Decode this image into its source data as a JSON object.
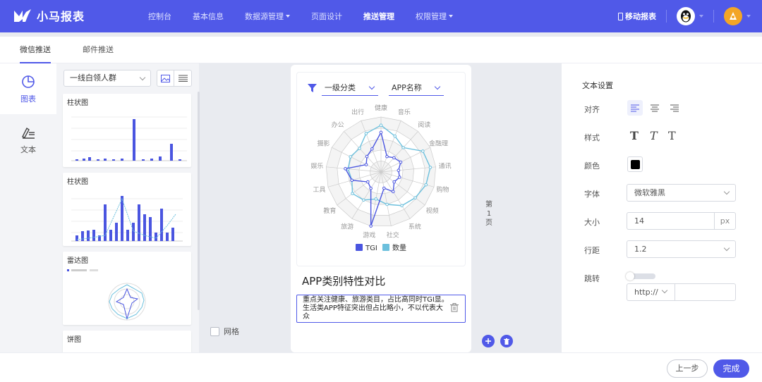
{
  "app": {
    "title": "小马报表"
  },
  "nav": [
    {
      "label": "控制台",
      "dropdown": false,
      "active": false
    },
    {
      "label": "基本信息",
      "dropdown": false,
      "active": false
    },
    {
      "label": "数据源管理",
      "dropdown": true,
      "active": false
    },
    {
      "label": "页面设计",
      "dropdown": false,
      "active": false
    },
    {
      "label": "推送管理",
      "dropdown": false,
      "active": true
    },
    {
      "label": "权限管理",
      "dropdown": true,
      "active": false
    }
  ],
  "header": {
    "mobile_label": "移动报表"
  },
  "tabs": [
    {
      "label": "微信推送",
      "active": true
    },
    {
      "label": "邮件推送",
      "active": false
    }
  ],
  "chart_types": [
    {
      "label": "图表",
      "icon": "pie-chart-icon",
      "active": true
    },
    {
      "label": "文本",
      "icon": "text-pen-icon",
      "active": false
    }
  ],
  "audience_select": {
    "value": "一线白领人群"
  },
  "templates": [
    {
      "title": "柱状图"
    },
    {
      "title": "柱状图"
    },
    {
      "title": "雷达图"
    },
    {
      "title": "饼图"
    }
  ],
  "canvas": {
    "grid_label": "网格",
    "filter1": "一级分类",
    "filter2": "APP名称",
    "chart_title": "APP类别特性对比",
    "chart_desc": "重点关注健康、旅游类目，占比高同时TGI显。生活类APP特征突出但占比略小，不以代表大众",
    "pager": [
      "第",
      "1",
      "页"
    ]
  },
  "settings": {
    "section_title": "文本设置",
    "align_label": "对齐",
    "style_label": "样式",
    "color_label": "颜色",
    "color_value": "#000000",
    "font_label": "字体",
    "font_value": "微软雅黑",
    "size_label": "大小",
    "size_value": "14",
    "size_unit": "px",
    "line_label": "行距",
    "line_value": "1.2",
    "jump_label": "跳转",
    "protocol": "http://",
    "style_glyphs": [
      "T",
      "T",
      "T"
    ]
  },
  "footer": {
    "prev_label": "上一步",
    "done_label": "完成"
  },
  "colors": {
    "primary": "#5059e8",
    "series_tgi": "#4a55e0",
    "series_share": "#6cc0dd"
  },
  "chart_data": {
    "type": "radar",
    "categories": [
      "健康",
      "音乐",
      "阅读",
      "金融理",
      "通讯",
      "购物",
      "视频",
      "系统",
      "社交",
      "游戏",
      "旅游",
      "教育",
      "工具",
      "娱乐",
      "摄影",
      "办公",
      "出行"
    ],
    "series": [
      {
        "name": "TGI",
        "values": [
          0.72,
          0.3,
          0.35,
          0.4,
          0.32,
          0.35,
          0.3,
          0.42,
          0.3,
          1.0,
          0.35,
          0.3,
          0.55,
          0.65,
          0.3,
          0.38,
          0.45
        ]
      },
      {
        "name": "数量",
        "values": [
          0.85,
          0.7,
          0.6,
          0.85,
          0.9,
          0.85,
          0.78,
          0.72,
          0.6,
          0.5,
          0.6,
          0.65,
          0.55,
          0.6,
          0.62,
          0.58,
          0.75
        ]
      }
    ],
    "legend_position": "bottom"
  }
}
